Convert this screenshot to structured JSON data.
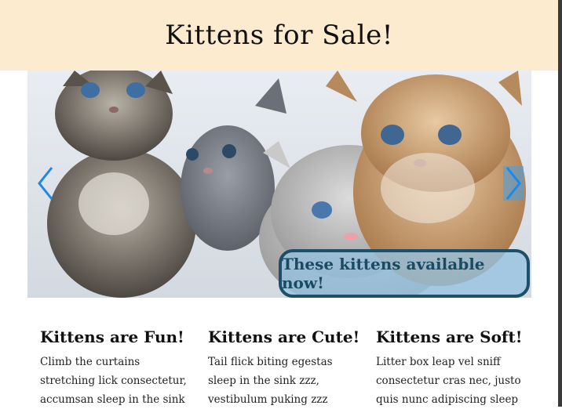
{
  "header": {
    "title": "Kittens for Sale!"
  },
  "carousel": {
    "caption": "These kittens available now!",
    "prev_icon": "chevron-left-icon",
    "next_icon": "chevron-right-icon",
    "accent_color": "#1e88e5"
  },
  "columns": [
    {
      "title": "Kittens are Fun!",
      "text": "Climb the curtains stretching lick consectetur, accumsan sleep in the sink"
    },
    {
      "title": "Kittens are Cute!",
      "text": "Tail flick biting egestas sleep in the sink zzz, vestibulum puking zzz"
    },
    {
      "title": "Kittens are Soft!",
      "text": "Litter box leap vel sniff consectetur cras nec, justo quis nunc adipiscing sleep"
    }
  ],
  "colors": {
    "header_bg": "#fdebd0",
    "caption_border": "#1e4f68",
    "caption_bg": "#96c3e1"
  }
}
